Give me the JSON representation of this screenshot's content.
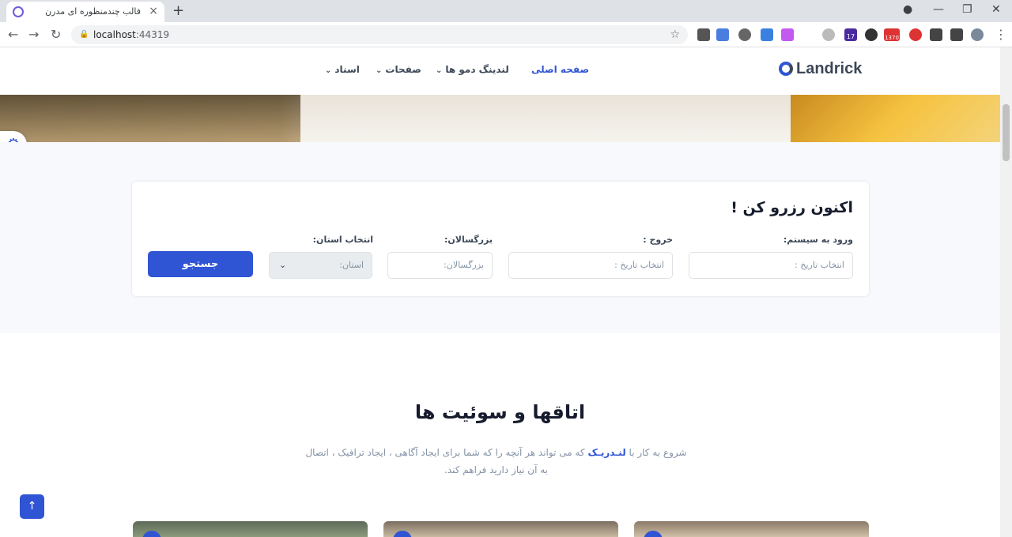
{
  "browser": {
    "tab_title": "قالب چندمنظوره ای مدرن",
    "url_host": "localhost",
    "url_port": ":44319",
    "badges": {
      "ext_count_a": "17",
      "ext_count_b": "1370"
    }
  },
  "nav": {
    "logo": "Landrick",
    "items": [
      {
        "label": "صفحه اصلی",
        "active": true
      },
      {
        "label": "لندینگ دمو ها",
        "active": false
      },
      {
        "label": "صفحات",
        "active": false
      },
      {
        "label": "اسناد",
        "active": false
      }
    ]
  },
  "booking": {
    "title": "اکنون رزرو کن !",
    "checkin_label": "ورود به سیستم:",
    "checkin_placeholder": "انتخاب تاریخ :",
    "checkout_label": "خروج :",
    "checkout_placeholder": "انتخاب تاریخ :",
    "adults_label": "بزرگسالان:",
    "adults_placeholder": "بزرگسالان:",
    "province_label": "انتخاب استان:",
    "province_selected": "استان:",
    "search_button": "جستجو"
  },
  "rooms": {
    "title": "اتاقها و سوئیت ها",
    "subtitle_before": "شروع به کار با",
    "brand": "لنـدریـک",
    "subtitle_after": "که می تواند هر آنچه را که شما برای ایجاد آگاهی ، ایجاد ترافیک ، اتصال به آن نیاز دارید فراهم کند."
  },
  "colors": {
    "primary": "#2f55d4",
    "heading": "#161c2d",
    "muted": "#8492a6"
  }
}
